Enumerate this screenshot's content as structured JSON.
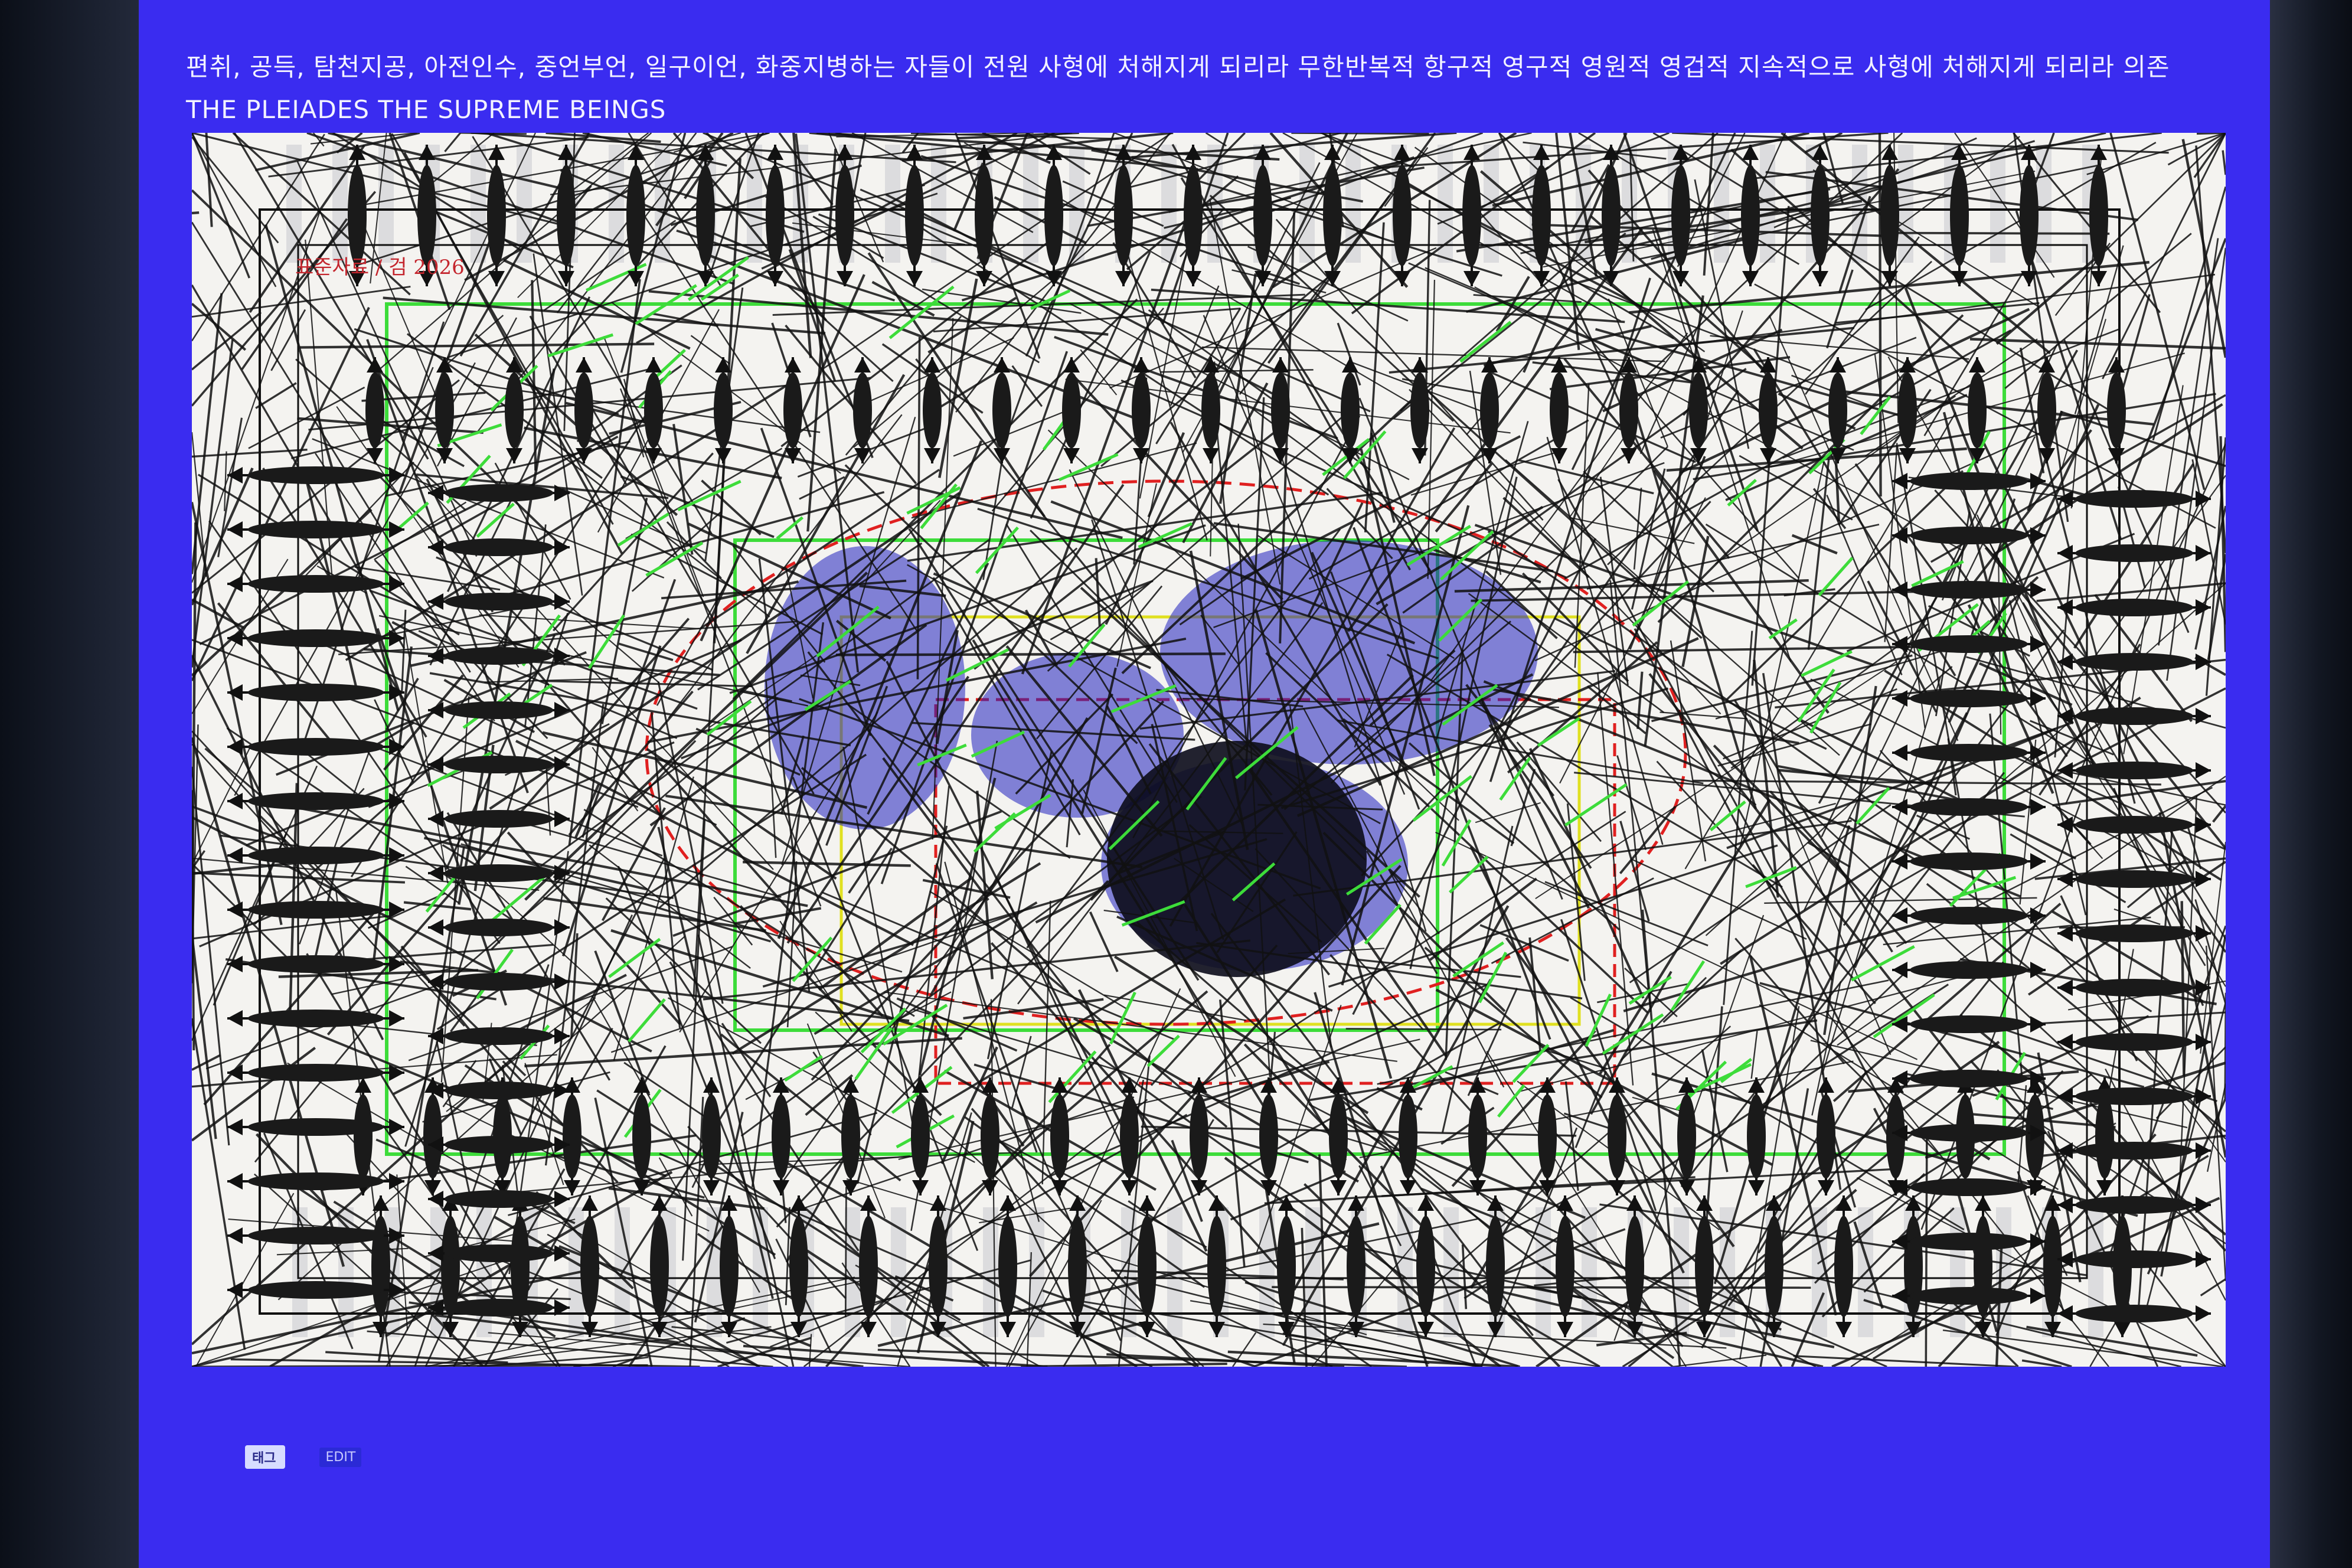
{
  "post": {
    "caption": "편취, 공득, 탐천지공, 아전인수, 중언부언, 일구이언, 화중지병하는 자들이 전원 사형에 처해지게 되리라 무한반복적 항구적 영구적 영원적 영겁적 지속적으로 사형에 처해지게 되리라 의존 THE PLEIADES THE SUPREME BEINGS",
    "artwork_stamp": "표준자료 / 검 2026"
  },
  "footer": {
    "tag_label": "태그",
    "edit_label": "EDIT"
  },
  "colors": {
    "screen_background": "#3a2cf0",
    "artwork_background": "#f4f3f0",
    "green_frame": "#3ddc3a",
    "red_frame": "#e02020",
    "yellow_frame": "#e0e020",
    "blue_scribble": "#2020c0"
  }
}
